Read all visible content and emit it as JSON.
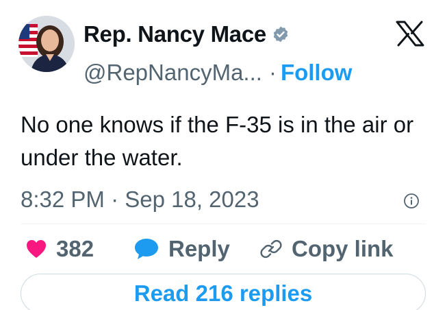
{
  "author": {
    "display_name": "Rep. Nancy Mace",
    "handle": "@RepNancyMa...",
    "verified_icon": "verified-badge-icon",
    "follow_label": "Follow",
    "separator": "·"
  },
  "platform_icon": "x-logo-icon",
  "tweet": {
    "text": "No one knows if the F-35 is in the air or under the water.",
    "timestamp": "8:32 PM · Sep 18, 2023"
  },
  "actions": {
    "like_count": "382",
    "reply_label": "Reply",
    "copy_link_label": "Copy link"
  },
  "read_replies_label": "Read 216 replies",
  "colors": {
    "accent": "#1d9bf0",
    "like": "#f91880",
    "muted": "#536471",
    "text": "#0f1419",
    "verified": "#829aab"
  }
}
